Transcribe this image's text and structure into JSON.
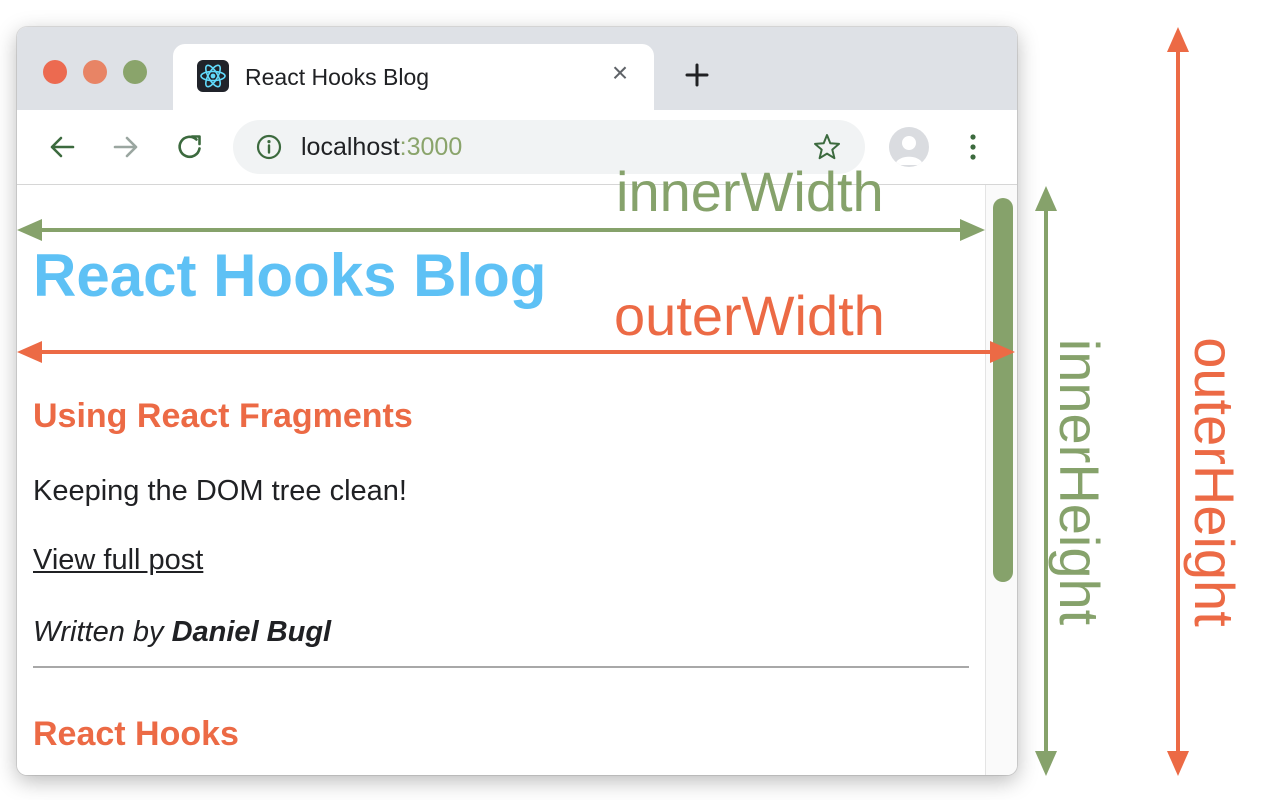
{
  "browser": {
    "tab": {
      "title": "React Hooks Blog",
      "close_glyph": "×",
      "favicon": "react-logo-icon"
    },
    "new_tab_icon": "plus-icon",
    "toolbar": {
      "back_icon": "arrow-left-icon",
      "forward_icon": "arrow-right-icon",
      "reload_icon": "reload-icon",
      "info_icon": "info-icon",
      "url_host": "localhost",
      "url_port": ":3000",
      "bookmark_icon": "star-icon",
      "avatar_icon": "profile-avatar-icon",
      "menu_icon": "kebab-menu-icon"
    }
  },
  "page": {
    "title": "React Hooks Blog",
    "posts": [
      {
        "title": "Using React Fragments",
        "content": "Keeping the DOM tree clean!",
        "link": "View full post",
        "author_prefix": "Written by ",
        "author": "Daniel Bugl"
      },
      {
        "title": "React Hooks"
      }
    ]
  },
  "annotations": {
    "inner_width": "innerWidth",
    "outer_width": "outerWidth",
    "inner_height": "innerHeight",
    "outer_height": "outerHeight"
  },
  "colors": {
    "inner": "#86a26b",
    "outer": "#ec6a45",
    "page_title": "#5ec1f5",
    "post_title": "#ec6a45",
    "traffic_close": "#ec6a50",
    "traffic_min": "#e88465",
    "traffic_max": "#8aa46b"
  }
}
